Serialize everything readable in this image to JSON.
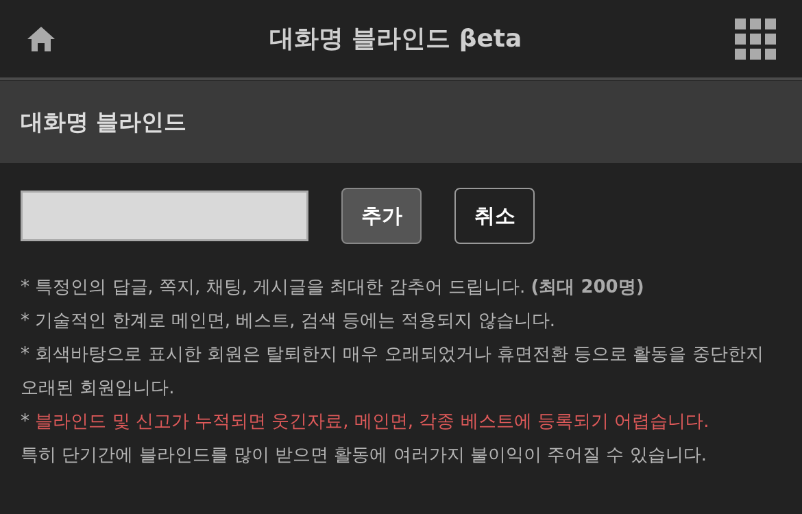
{
  "header": {
    "title": "대화명 블라인드 βeta"
  },
  "section": {
    "title": "대화명 블라인드"
  },
  "form": {
    "buttons": [
      {
        "label": "추가",
        "kind": "primary"
      },
      {
        "label": "취소",
        "kind": "secondary"
      }
    ]
  },
  "notes": [
    {
      "marker": "*",
      "text": "특정인의 답글, 쪽지, 채팅, 게시글을 최대한 감추어 드립니다. **(최대 200명)**",
      "kind": "info"
    },
    {
      "marker": "*",
      "text": "기술적인 한계로 메인면, 베스트, 검색 등에는 적용되지 않습니다.",
      "kind": "info"
    },
    {
      "marker": "*",
      "text": "회색바탕으로 표시한 회원은 탈퇴한지 매우 오래되었거나 휴면전환 등으로 활동을 중단한지 오래된 회원입니다.",
      "kind": "info"
    },
    {
      "marker": "*",
      "text": "블라인드 및 신고가 누적되면 웃긴자료, 메인면, 각종 베스트에 등록되기 어렵습니다.",
      "kind": "warning"
    },
    {
      "text": "특히 단기간에 블라인드를 많이 받으면 활동에 여러가지 불이익이 주어질 수 있습니다.",
      "kind": "info"
    }
  ]
}
